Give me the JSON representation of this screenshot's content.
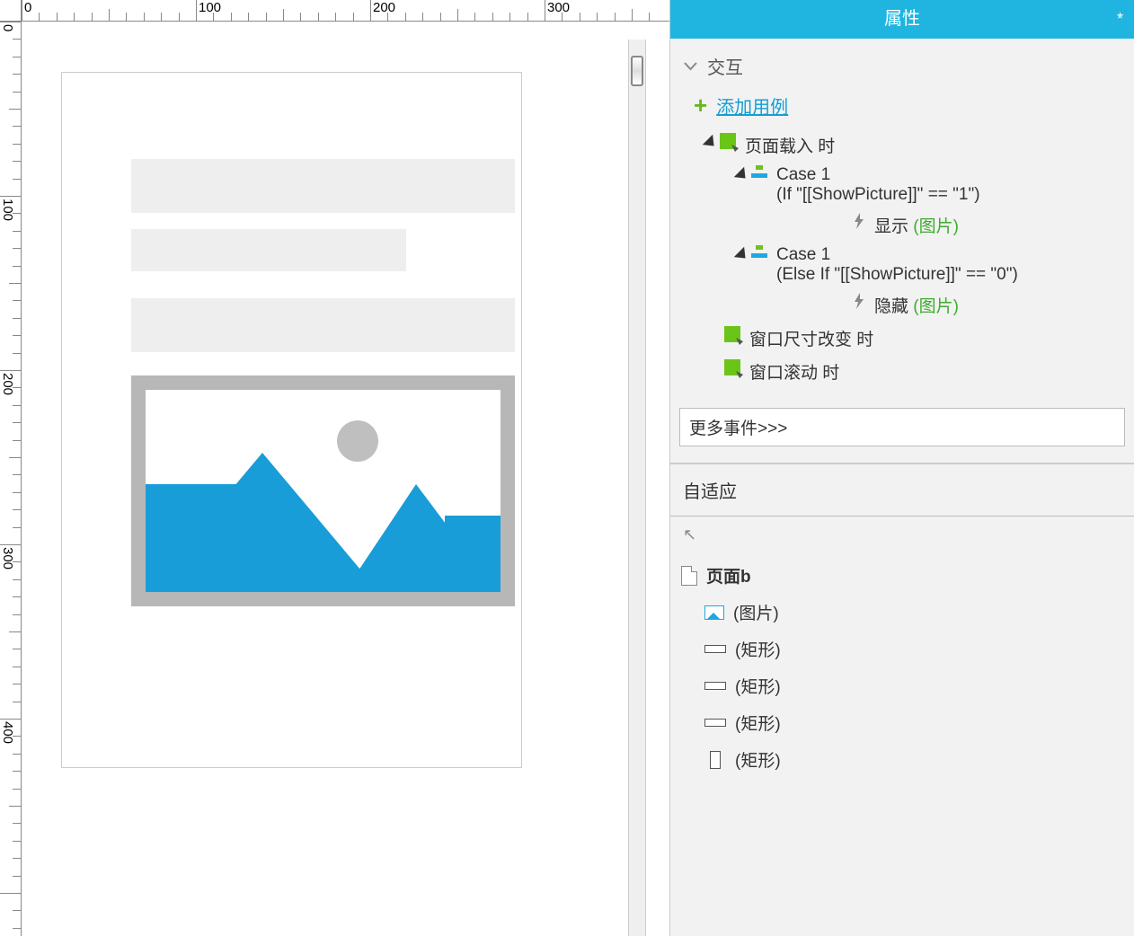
{
  "ruler": {
    "major_labels": [
      "0",
      "100",
      "200",
      "300"
    ],
    "v_major_labels": [
      "0",
      "100",
      "200",
      "300",
      "400"
    ]
  },
  "panel": {
    "title": "属性",
    "modified_indicator": "*",
    "interaction_section": "交互",
    "add_case": "添加用例",
    "events": {
      "page_load": "页面载入 时",
      "case1_name": "Case 1",
      "case1_cond": "(If \"[[ShowPicture]]\" == \"1\")",
      "action_show": "显示",
      "action_show_target": "(图片)",
      "case2_name": "Case 1",
      "case2_cond": "(Else If \"[[ShowPicture]]\" == \"0\")",
      "action_hide": "隐藏",
      "action_hide_target": "(图片)",
      "resize": "窗口尺寸改变 时",
      "scroll": "窗口滚动 时"
    },
    "more_events": "更多事件>>>",
    "adaptive": "自适应",
    "outline_popout": "↖"
  },
  "outline": {
    "page_name": "页面b",
    "items": [
      {
        "label": "(图片)",
        "type": "image"
      },
      {
        "label": "(矩形)",
        "type": "rect_h"
      },
      {
        "label": "(矩形)",
        "type": "rect_h"
      },
      {
        "label": "(矩形)",
        "type": "rect_h"
      },
      {
        "label": "(矩形)",
        "type": "rect_v"
      }
    ]
  }
}
